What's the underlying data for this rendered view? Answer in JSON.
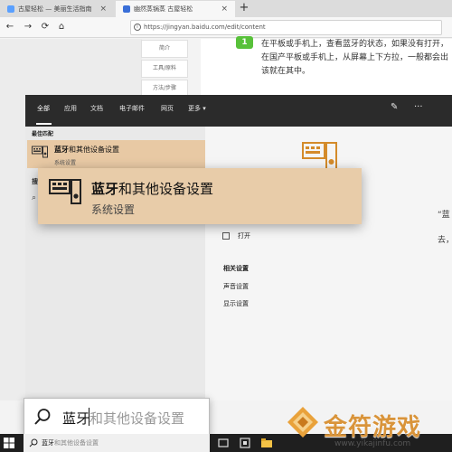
{
  "browser": {
    "tabs": [
      {
        "label": "古屋轻松 — 美丽生活指南"
      },
      {
        "label": "幽然蒸锅蒸 古屋轻松"
      }
    ],
    "url": "https://jingyan.baidu.com/edit/content"
  },
  "article": {
    "nav_items": [
      "简介",
      "工具/原料",
      "方法/步骤"
    ],
    "step_number": "1",
    "step_text": "在平板或手机上，查看蓝牙的状态，如果没有打开，在国产平板或手机上，从屏幕上下方拉，一般都会出该就在其中。",
    "fragments": [
      "“蓝",
      "去，"
    ]
  },
  "start_menu": {
    "tabs": [
      "全部",
      "应用",
      "文档",
      "电子邮件",
      "网页",
      "更多 ▾"
    ],
    "best_match_label": "最佳匹配",
    "result_title_bold": "蓝牙",
    "result_title_rest": "和其他设备设置",
    "result_subtitle": "系统设置",
    "left_fragment": "搜",
    "actions": [
      {
        "label": "打开"
      }
    ],
    "related_title": "相关设置",
    "related_items": [
      "声音设置",
      "显示设置"
    ]
  },
  "search": {
    "typed": "蓝牙",
    "suggestion": "和其他设备设置"
  },
  "taskbar": {
    "search_typed": "蓝牙",
    "search_hint": "和其他设备设置"
  },
  "watermark": {
    "main": "金符游戏",
    "url": "www.yikajinfu.com"
  },
  "colors": {
    "accent": "#e8c9a4",
    "dark": "#2b2b2b",
    "step_green": "#58c13a"
  }
}
